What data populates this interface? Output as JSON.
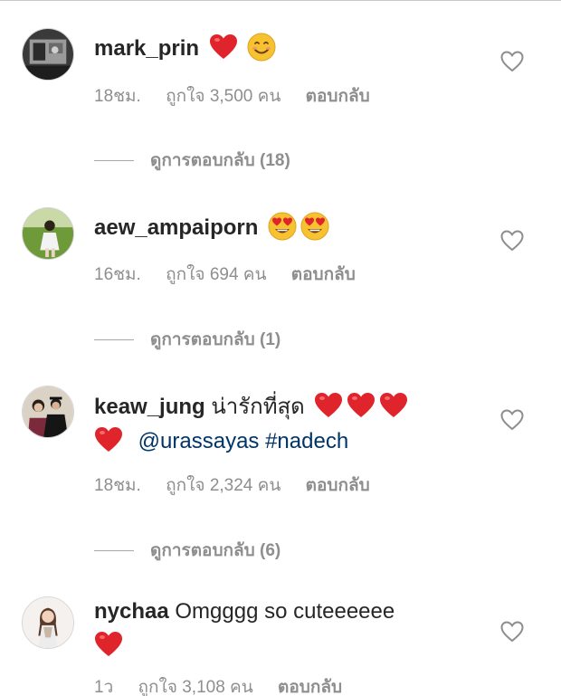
{
  "comments": [
    {
      "username": "mark_prin",
      "text": "",
      "emojis": [
        "red-heart",
        "smiling-face"
      ],
      "time": "18ชม.",
      "likes": "ถูกใจ 3,500 คน",
      "reply": "ตอบกลับ",
      "view_replies": "ดูการตอบกลับ (18)"
    },
    {
      "username": "aew_ampaiporn",
      "text": "",
      "emojis": [
        "heart-eyes",
        "heart-eyes"
      ],
      "time": "16ชม.",
      "likes": "ถูกใจ 694 คน",
      "reply": "ตอบกลับ",
      "view_replies": "ดูการตอบกลับ (1)"
    },
    {
      "username": "keaw_jung",
      "text": "น่ารักที่สุด",
      "emojis": [
        "red-heart",
        "red-heart",
        "red-heart",
        "red-heart"
      ],
      "mentions": "@urassayas #nadech",
      "time": "18ชม.",
      "likes": "ถูกใจ 2,324 คน",
      "reply": "ตอบกลับ",
      "view_replies": "ดูการตอบกลับ (6)"
    },
    {
      "username": "nychaa",
      "text": "Omgggg so cuteeeeee",
      "emojis": [
        "red-heart"
      ],
      "time": "1ว",
      "likes": "ถูกใจ 3,108 คน",
      "reply": "ตอบกลับ"
    }
  ],
  "colors": {
    "text": "#262626",
    "meta": "#8e8e8e",
    "mention": "#003569",
    "heart": "#e0242b",
    "emoji_face": "#f7c230"
  }
}
